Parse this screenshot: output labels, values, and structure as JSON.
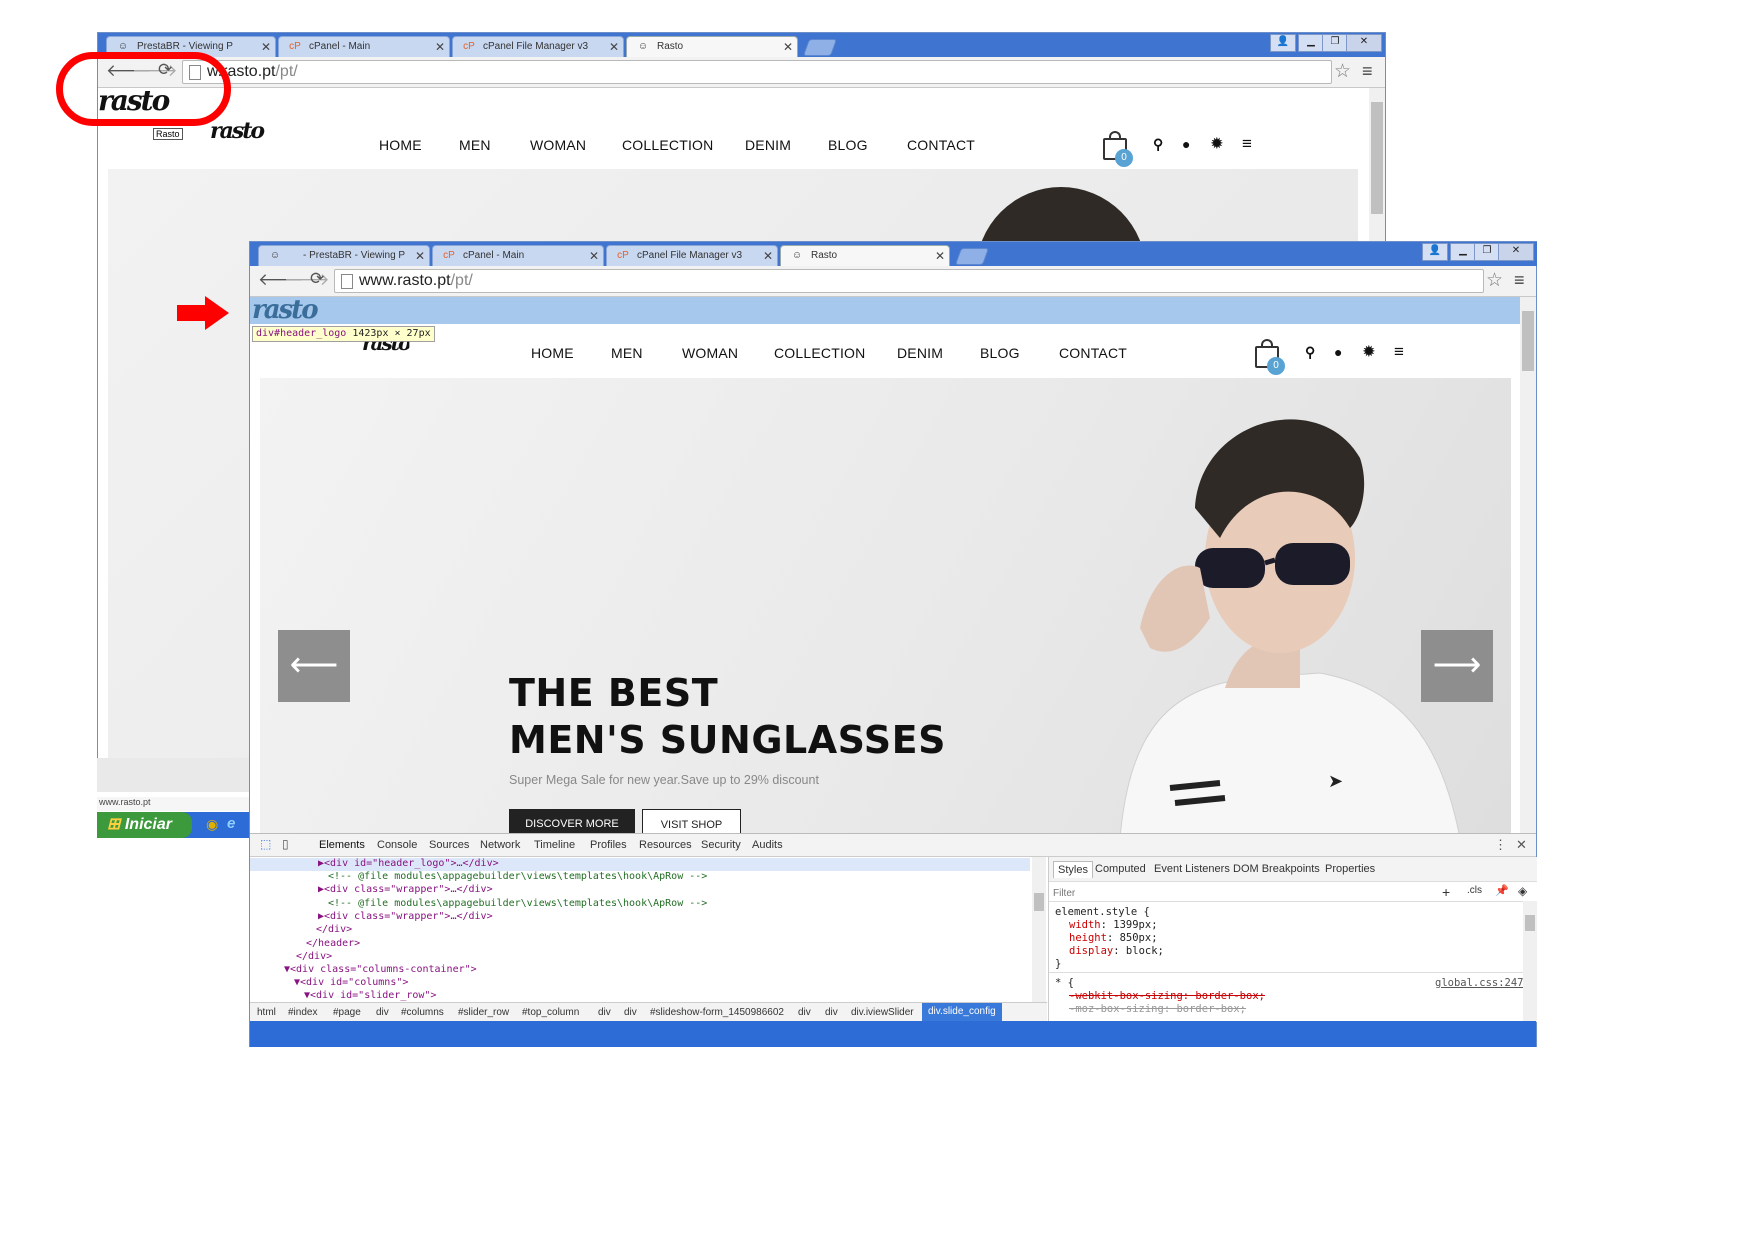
{
  "back_window": {
    "tabs": [
      {
        "label": "PrestaBR - Viewing P"
      },
      {
        "label": "cPanel - Main"
      },
      {
        "label": "cPanel File Manager v3"
      },
      {
        "label": "Rasto"
      }
    ],
    "url_host": "www.rasto.pt",
    "url_path": "/pt/",
    "url_shown": "w.rasto.pt",
    "logo_tooltip": "Rasto",
    "logo": "rasto",
    "nav": [
      "HOME",
      "MEN",
      "WOMAN",
      "COLLECTION",
      "DENIM",
      "BLOG",
      "CONTACT"
    ],
    "cart_count": "0",
    "status_url": "www.rasto.pt",
    "start_button": "Iniciar"
  },
  "front_window": {
    "tabs": [
      {
        "label": "- PrestaBR - Viewing P"
      },
      {
        "label": "cPanel - Main"
      },
      {
        "label": "cPanel File Manager v3"
      },
      {
        "label": "Rasto"
      }
    ],
    "url_host": "www.rasto.pt",
    "url_path": "/pt/",
    "logo": "rasto",
    "inspect_tooltip": {
      "tag": "div#header_logo",
      "size": "1423px × 27px"
    },
    "nav": [
      "HOME",
      "MEN",
      "WOMAN",
      "COLLECTION",
      "DENIM",
      "BLOG",
      "CONTACT"
    ],
    "cart_count": "0",
    "hero": {
      "title_line1": "THE BEST",
      "title_line2": "MEN'S SUNGLASSES",
      "subtitle": "Super Mega Sale for new year.Save up to 29% discount",
      "btn_primary": "DISCOVER MORE",
      "btn_secondary": "VISIT SHOP",
      "prev_arrow": "⟵",
      "next_arrow": "⟶"
    }
  },
  "devtools": {
    "tabs": [
      "Elements",
      "Console",
      "Sources",
      "Network",
      "Timeline",
      "Profiles",
      "Resources",
      "Security",
      "Audits"
    ],
    "code_lines": [
      "▶<div id=\"header_logo\">…</div>",
      "<!-- @file modules\\appagebuilder\\views\\templates\\hook\\ApRow -->",
      "▶<div class=\"wrapper\">…</div>",
      "<!-- @file modules\\appagebuilder\\views\\templates\\hook\\ApRow -->",
      "▶<div class=\"wrapper\">…</div>",
      "</div>",
      "</header>",
      "</div>",
      "▼<div class=\"columns-container\">",
      "▼<div id=\"columns\">",
      "▼<div id=\"slider_row\">"
    ],
    "breadcrumbs": [
      "html",
      "#index",
      "#page",
      "div",
      "#columns",
      "#slider_row",
      "#top_column",
      "div",
      "div",
      "#slideshow-form_1450986602",
      "div",
      "div",
      "div.iviewSlider",
      "div.slide_config"
    ],
    "styles_tabs": [
      "Styles",
      "Computed",
      "Event Listeners",
      "DOM Breakpoints",
      "Properties"
    ],
    "filter_placeholder": "Filter",
    "cls_label": ".cls",
    "element_style": {
      "selector": "element.style {",
      "rules": [
        {
          "prop": "width",
          "val": "1399px;"
        },
        {
          "prop": "height",
          "val": "850px;"
        },
        {
          "prop": "display",
          "val": "block;"
        }
      ],
      "close": "}"
    },
    "star_rule": {
      "selector": "* {",
      "source": "global.css:247",
      "struck": [
        "-webkit-box-sizing: border-box;",
        "-moz-box-sizing: border-box;"
      ]
    }
  },
  "colors": {
    "taskbar": "#2d6bd6",
    "highlight": "#a6c8ec",
    "annotation": "#ff0000",
    "cart_badge": "#58a3d4"
  }
}
